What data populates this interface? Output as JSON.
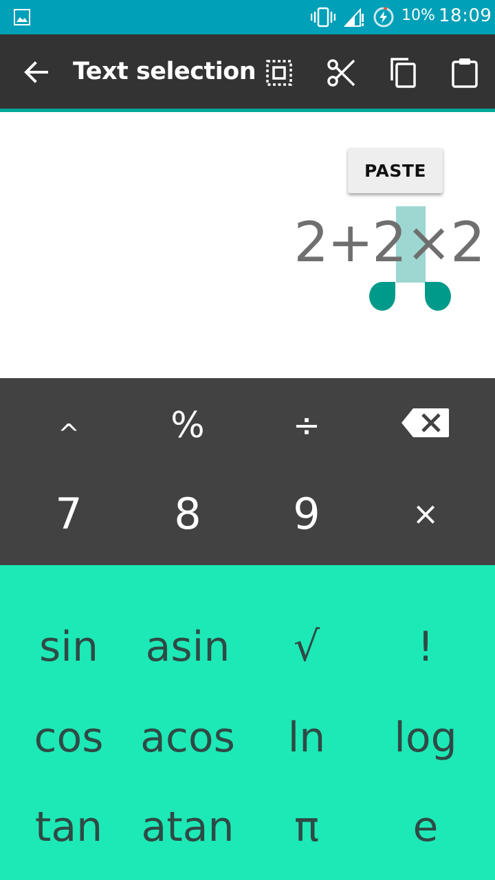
{
  "status_bar": {
    "battery_percent": "10%",
    "time": "18:09",
    "icons": [
      "gallery-icon",
      "vibrate-icon",
      "signal-icon",
      "battery-charging-icon"
    ]
  },
  "toolbar": {
    "title": "Text selection",
    "icons": [
      "back-arrow-icon",
      "select-all-icon",
      "cut-icon",
      "copy-icon",
      "paste-icon"
    ]
  },
  "display": {
    "paste_label": "PASTE",
    "formula": "2+2×2",
    "selected_text": "2"
  },
  "keypad_main": {
    "row1": [
      "^",
      "%",
      "÷"
    ],
    "backspace_icon": "backspace-icon",
    "row2": [
      "7",
      "8",
      "9",
      "×"
    ]
  },
  "keypad_advanced": {
    "row1": [
      "sin",
      "asin",
      "√",
      "!"
    ],
    "row2": [
      "cos",
      "acos",
      "ln",
      "log"
    ],
    "row3": [
      "tan",
      "atan",
      "π",
      "e"
    ]
  },
  "colors": {
    "status_bar": "#00a0b8",
    "toolbar": "#333333",
    "toolbar_accent": "#00a89a",
    "keypad_dark": "#424242",
    "advanced_panel": "#1de9b6",
    "selection": "#9ed7d1",
    "handle": "#009a8a"
  }
}
